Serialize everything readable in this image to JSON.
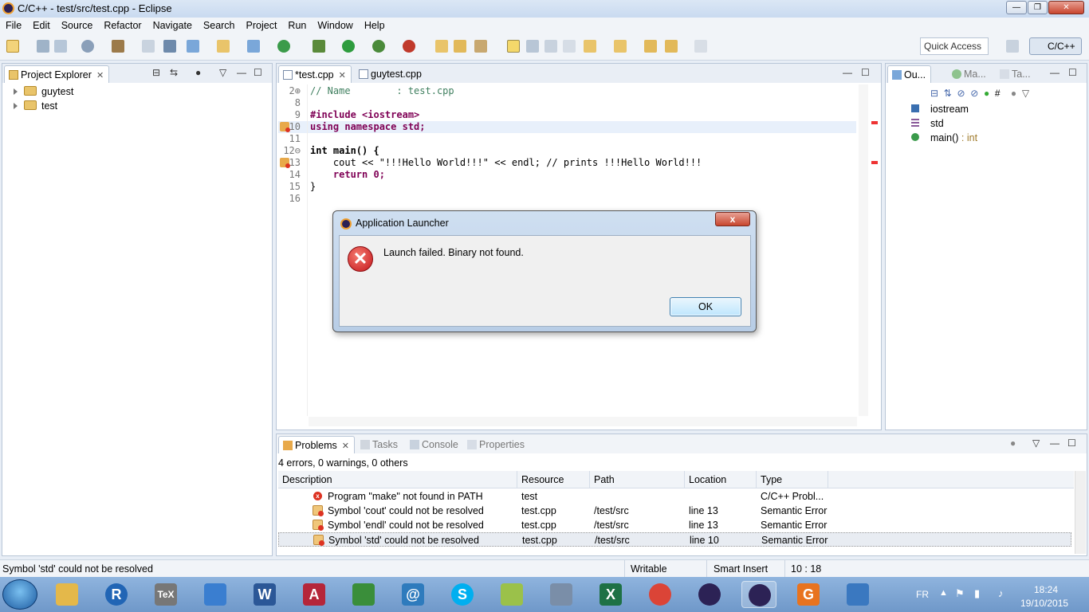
{
  "window": {
    "title": "C/C++ - test/src/test.cpp - Eclipse",
    "min": "—",
    "max": "❐",
    "close": "✕"
  },
  "menu": [
    "File",
    "Edit",
    "Source",
    "Refactor",
    "Navigate",
    "Search",
    "Project",
    "Run",
    "Window",
    "Help"
  ],
  "toolbar": {
    "quick_access_placeholder": "Quick Access",
    "perspective": "C/C++"
  },
  "project_explorer": {
    "title": "Project Explorer",
    "items": [
      {
        "label": "guytest"
      },
      {
        "label": "test"
      }
    ]
  },
  "editor": {
    "tabs": [
      {
        "label": "*test.cpp"
      },
      {
        "label": "guytest.cpp"
      }
    ],
    "lines": [
      {
        "num": "2⊕",
        "text": "// Name        : test.cpp"
      },
      {
        "num": "8",
        "text": ""
      },
      {
        "num": "9",
        "text": "#include <iostream>"
      },
      {
        "num": "10",
        "text": "using namespace std;"
      },
      {
        "num": "11",
        "text": ""
      },
      {
        "num": "12⊖",
        "text": "int main() {"
      },
      {
        "num": "13",
        "text": "    cout << \"!!!Hello World!!!\" << endl; // prints !!!Hello World!!!"
      },
      {
        "num": "14",
        "text": "    return 0;"
      },
      {
        "num": "15",
        "text": "}"
      },
      {
        "num": "16",
        "text": ""
      }
    ]
  },
  "outline": {
    "tabs": [
      {
        "label": "Ou..."
      },
      {
        "label": "Ma..."
      },
      {
        "label": "Ta..."
      }
    ],
    "items": [
      {
        "label": "iostream",
        "type": ""
      },
      {
        "label": "std",
        "type": ""
      },
      {
        "label": "main()",
        "type": " : int"
      }
    ]
  },
  "dialog": {
    "title": "Application Launcher",
    "message": "Launch failed. Binary not found.",
    "ok": "OK",
    "close": "x"
  },
  "problems": {
    "tabs": [
      {
        "label": "Problems"
      },
      {
        "label": "Tasks"
      },
      {
        "label": "Console"
      },
      {
        "label": "Properties"
      }
    ],
    "summary": "4 errors, 0 warnings, 0 others",
    "columns": [
      "Description",
      "Resource",
      "Path",
      "Location",
      "Type"
    ],
    "rows": [
      {
        "icon": "error",
        "description": "Program \"make\" not found in PATH",
        "resource": "test",
        "path": "",
        "location": "",
        "type": "C/C++ Probl..."
      },
      {
        "icon": "semantic",
        "description": "Symbol 'cout' could not be resolved",
        "resource": "test.cpp",
        "path": "/test/src",
        "location": "line 13",
        "type": "Semantic Error"
      },
      {
        "icon": "semantic",
        "description": "Symbol 'endl' could not be resolved",
        "resource": "test.cpp",
        "path": "/test/src",
        "location": "line 13",
        "type": "Semantic Error"
      },
      {
        "icon": "semantic",
        "description": "Symbol 'std' could not be resolved",
        "resource": "test.cpp",
        "path": "/test/src",
        "location": "line 10",
        "type": "Semantic Error"
      }
    ]
  },
  "status": {
    "message": "Symbol 'std' could not be resolved",
    "writable": "Writable",
    "insert_mode": "Smart Insert",
    "position": "10 : 18"
  },
  "taskbar": {
    "language": "FR",
    "time": "18:24",
    "date": "19/10/2015",
    "apps": [
      {
        "name": "file-explorer-icon",
        "glyph": "",
        "color": "#e4b84a"
      },
      {
        "name": "r-icon",
        "glyph": "R",
        "color": "#2165b5"
      },
      {
        "name": "tex-icon",
        "glyph": "TeX",
        "color": "#777"
      },
      {
        "name": "browser-icon",
        "glyph": "",
        "color": "#3a7ed0"
      },
      {
        "name": "word-icon",
        "glyph": "W",
        "color": "#2b5797"
      },
      {
        "name": "access-icon",
        "glyph": "A",
        "color": "#b5263a"
      },
      {
        "name": "books-icon",
        "glyph": "",
        "color": "#3a8e3a"
      },
      {
        "name": "network-icon",
        "glyph": "@",
        "color": "#2e7bbd"
      },
      {
        "name": "skype-icon",
        "glyph": "S",
        "color": "#00aff0"
      },
      {
        "name": "notes-icon",
        "glyph": "",
        "color": "#9bc14a"
      },
      {
        "name": "tools-icon",
        "glyph": "",
        "color": "#7a8ea8"
      },
      {
        "name": "excel-icon",
        "glyph": "X",
        "color": "#1e7145"
      },
      {
        "name": "chrome-icon",
        "glyph": "",
        "color": "#db4437"
      },
      {
        "name": "eclipse-icon",
        "glyph": "",
        "color": "#2c2255"
      },
      {
        "name": "eclipse-active-icon",
        "glyph": "",
        "color": "#2c2255"
      },
      {
        "name": "pdf-icon",
        "glyph": "G",
        "color": "#e8731f"
      },
      {
        "name": "control-panel-icon",
        "glyph": "",
        "color": "#3a78c0"
      }
    ]
  }
}
